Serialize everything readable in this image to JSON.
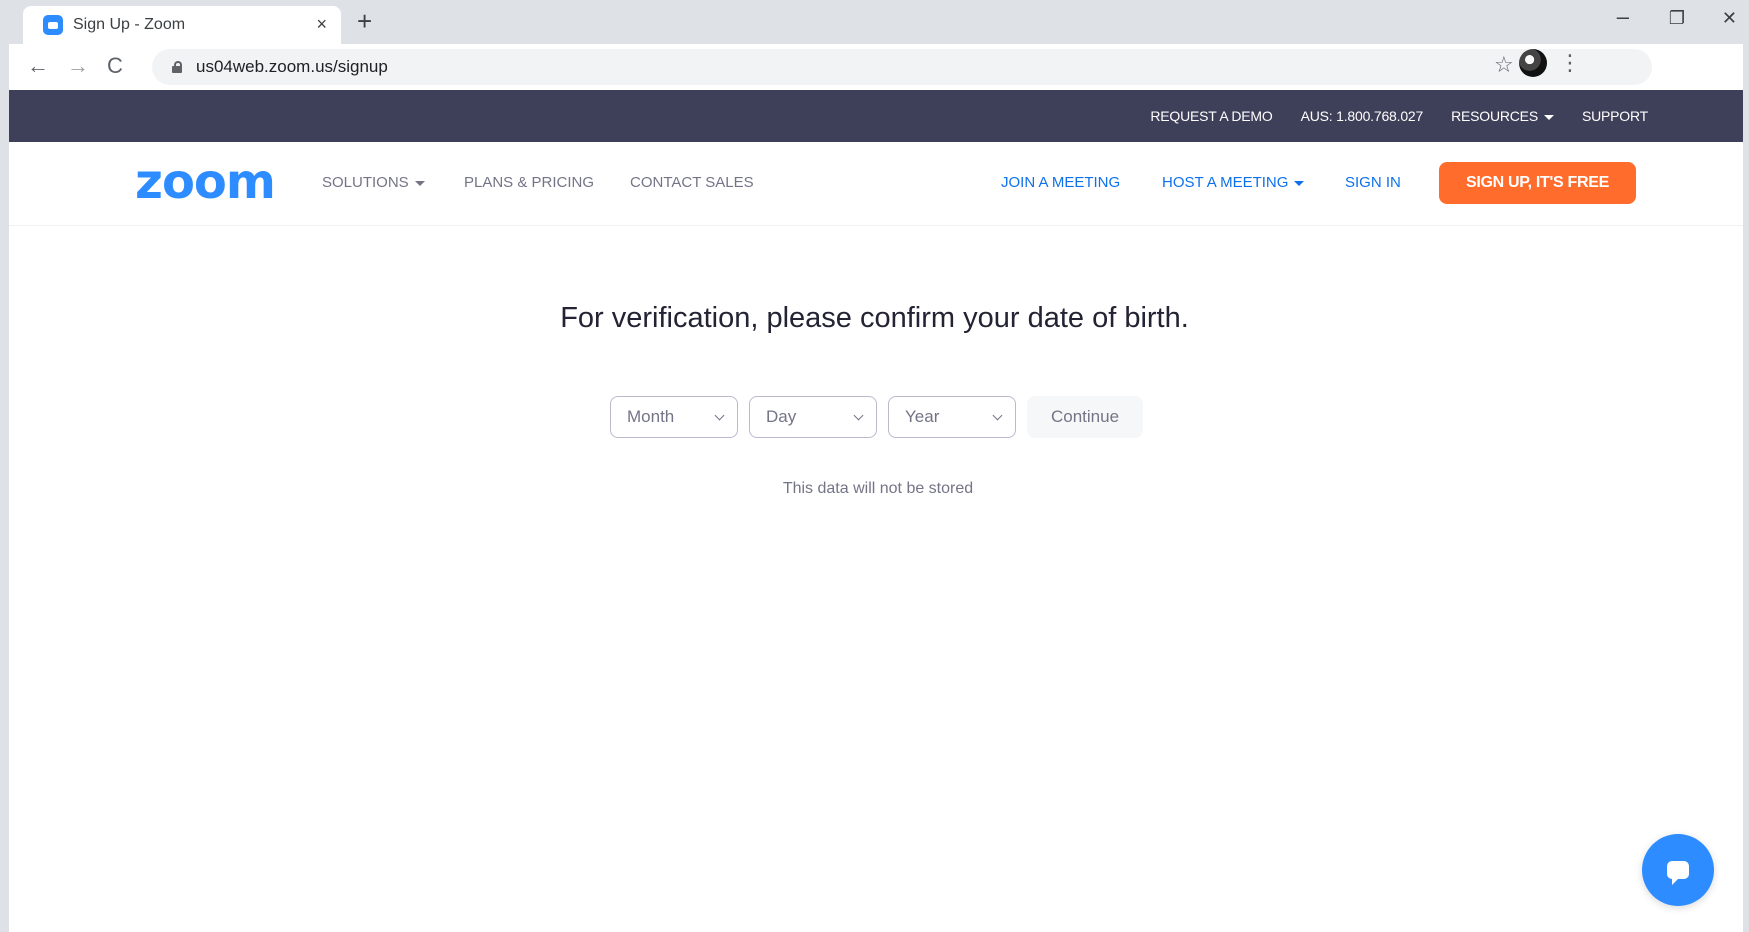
{
  "browser": {
    "tab_title": "Sign Up - Zoom",
    "tab_close": "×",
    "new_tab": "+",
    "url": "us04web.zoom.us/signup",
    "window_min": "–",
    "window_max": "❐",
    "window_close": "✕",
    "icons": {
      "back": "←",
      "forward": "→",
      "reload": "C",
      "star": "☆",
      "menu": "⋮"
    }
  },
  "topbar": {
    "request_demo": "REQUEST A DEMO",
    "phone": "AUS: 1.800.768.027",
    "resources": "RESOURCES",
    "support": "SUPPORT"
  },
  "nav": {
    "logo": "zoom",
    "solutions": "SOLUTIONS",
    "plans_pricing": "PLANS & PRICING",
    "contact_sales": "CONTACT SALES",
    "join_meeting": "JOIN A MEETING",
    "host_meeting": "HOST A MEETING",
    "sign_in": "SIGN IN",
    "sign_up": "SIGN UP, IT'S FREE"
  },
  "verification": {
    "heading": "For verification, please confirm your date of birth.",
    "month": "Month",
    "day": "Day",
    "year": "Year",
    "continue": "Continue",
    "note": "This data will not be stored"
  },
  "colors": {
    "brand_blue": "#2d8cff",
    "topbar_bg": "#3e3f58",
    "signup_orange": "#ff6c2c",
    "link_blue": "#0e71eb"
  }
}
